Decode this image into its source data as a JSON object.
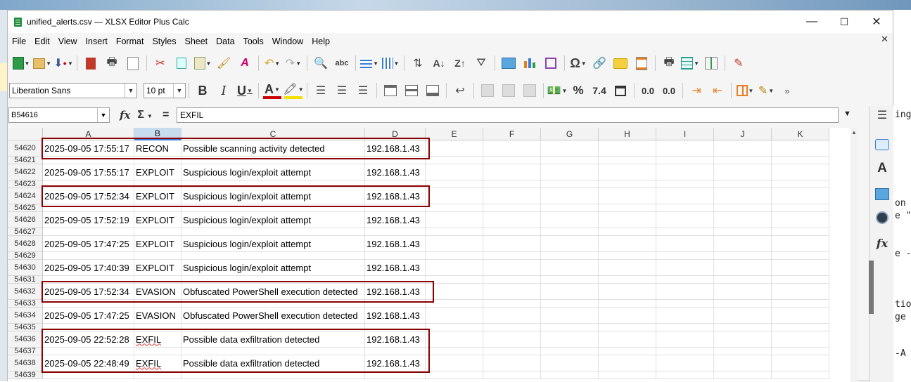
{
  "window": {
    "title": "unified_alerts.csv — XLSX Editor Plus Calc",
    "minimize": "—",
    "maximize": "☐",
    "close": "✕"
  },
  "menu": {
    "items": [
      "File",
      "Edit",
      "View",
      "Insert",
      "Format",
      "Styles",
      "Sheet",
      "Data",
      "Tools",
      "Window",
      "Help"
    ],
    "doc_close": "✕"
  },
  "toolbar2": {
    "font_name": "Liberation Sans",
    "font_size": "10 pt",
    "percent": "%",
    "number": "7.4",
    "dec_add": "0.0",
    "dec_del": "0.0"
  },
  "formula_bar": {
    "name_box": "B54616",
    "fx": "fx",
    "sigma": "Σ",
    "equals": "=",
    "content": "EXFIL"
  },
  "columns": [
    "A",
    "B",
    "C",
    "D",
    "E",
    "F",
    "G",
    "H",
    "I",
    "J",
    "K"
  ],
  "selected_column": "B",
  "rows": [
    {
      "num": "54620",
      "cells": [
        "2025-09-05 17:55:17",
        "RECON",
        "Possible scanning activity detected",
        "192.168.1.43"
      ]
    },
    {
      "num": "54621",
      "cells": [
        "",
        "",
        "",
        ""
      ]
    },
    {
      "num": "54622",
      "cells": [
        "2025-09-05 17:55:17",
        "EXPLOIT",
        "Suspicious login/exploit attempt",
        "192.168.1.43"
      ]
    },
    {
      "num": "54623",
      "cells": [
        "",
        "",
        "",
        ""
      ]
    },
    {
      "num": "54624",
      "cells": [
        "2025-09-05 17:52:34",
        "EXPLOIT",
        "Suspicious login/exploit attempt",
        "192.168.1.43"
      ]
    },
    {
      "num": "54625",
      "cells": [
        "",
        "",
        "",
        ""
      ]
    },
    {
      "num": "54626",
      "cells": [
        "2025-09-05 17:52:19",
        "EXPLOIT",
        "Suspicious login/exploit attempt",
        "192.168.1.43"
      ]
    },
    {
      "num": "54627",
      "cells": [
        "",
        "",
        "",
        ""
      ]
    },
    {
      "num": "54628",
      "cells": [
        "2025-09-05 17:47:25",
        "EXPLOIT",
        "Suspicious login/exploit attempt",
        "192.168.1.43"
      ]
    },
    {
      "num": "54629",
      "cells": [
        "",
        "",
        "",
        ""
      ]
    },
    {
      "num": "54630",
      "cells": [
        "2025-09-05 17:40:39",
        "EXPLOIT",
        "Suspicious login/exploit attempt",
        "192.168.1.43"
      ]
    },
    {
      "num": "54631",
      "cells": [
        "",
        "",
        "",
        ""
      ]
    },
    {
      "num": "54632",
      "cells": [
        "2025-09-05 17:52:34",
        "EVASION",
        "Obfuscated PowerShell execution detected",
        "192.168.1.43"
      ]
    },
    {
      "num": "54633",
      "cells": [
        "",
        "",
        "",
        ""
      ]
    },
    {
      "num": "54634",
      "cells": [
        "2025-09-05 17:47:25",
        "EVASION",
        "Obfuscated PowerShell execution detected",
        "192.168.1.43"
      ]
    },
    {
      "num": "54635",
      "cells": [
        "",
        "",
        "",
        ""
      ]
    },
    {
      "num": "54636",
      "cells": [
        "2025-09-05 22:52:28",
        "EXFIL",
        "Possible data exfiltration detected",
        "192.168.1.43"
      ]
    },
    {
      "num": "54637",
      "cells": [
        "",
        "",
        "",
        ""
      ]
    },
    {
      "num": "54638",
      "cells": [
        "2025-09-05 22:48:49",
        "EXFIL",
        "Possible data exfiltration detected",
        "192.168.1.43"
      ]
    },
    {
      "num": "54639",
      "cells": [
        "",
        "",
        "",
        ""
      ]
    }
  ],
  "background_text": [
    "ing",
    "on",
    "e \"",
    "e -",
    "tio",
    "ge",
    "-A"
  ],
  "colors": {
    "highlight_box": "#8b0000",
    "selected_column": "#c8dcf0"
  }
}
